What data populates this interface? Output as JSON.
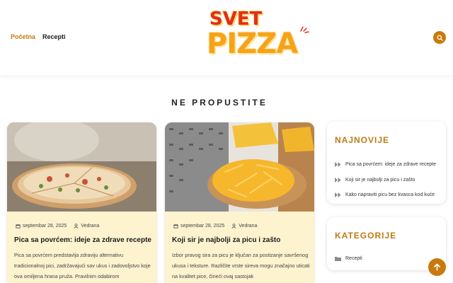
{
  "nav": {
    "items": [
      {
        "label": "Početna",
        "active": true
      },
      {
        "label": "Recepti",
        "active": false
      }
    ]
  },
  "logo": {
    "line1": "SVET",
    "line2": "PIZZA"
  },
  "section_title": "NE PROPUSTITE",
  "posts": [
    {
      "date": "septembar 28, 2025",
      "author": "Vedrana",
      "title": "Pica sa povrćem: ideje za zdrave recepte",
      "excerpt": "Pica sa povrćem predstavlja zdraviju alternativu tradicionalnoj pici, zadržavajući sav ukus i zadovoljstvo koje ova omiljena hrana pruža. Pravilnim odabirom"
    },
    {
      "date": "septembar 28, 2025",
      "author": "Vedrana",
      "title": "Koji sir je najbolji za picu i zašto",
      "excerpt": "Izbor pravog sira za picu je ključan za postizanje savršenog ukusa i teksture. Različite vrste sireva mogu značajno uticati na kvalitet pice, čineći ovaj sastojak"
    }
  ],
  "sidebar": {
    "latest": {
      "title": "NAJNOVIJE",
      "items": [
        "Pica sa povrćem: ideje za zdrave recepte",
        "Koji sir je najbolji za picu i zašto",
        "Kako napraviti picu bez kvasca kod kuće"
      ]
    },
    "categories": {
      "title": "KATEGORIJE",
      "items": [
        "Recepti"
      ]
    }
  },
  "colors": {
    "accent": "#c87a0d",
    "card_bg": "#fdf3cf",
    "logo_red": "#e32c1f",
    "logo_orange": "#f7a21b"
  },
  "icons": {
    "search": "search-icon",
    "arrow_up": "arrow-up-icon",
    "calendar": "calendar-icon",
    "user": "user-icon"
  }
}
